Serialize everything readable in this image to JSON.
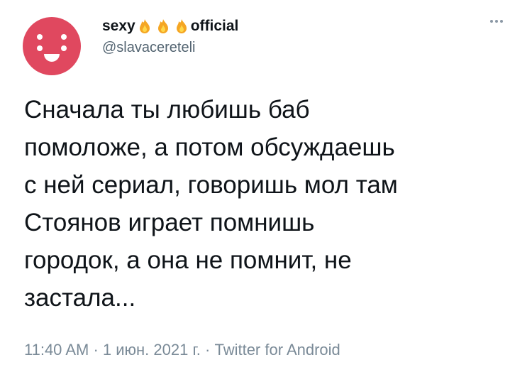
{
  "author": {
    "name_prefix": "sexy",
    "name_suffix": "official",
    "handle": "@slavacereteli",
    "avatar_color": "#e0485f"
  },
  "icons": {
    "fire": "fire-emoji",
    "more": "more-options-icon"
  },
  "tweet": {
    "text": "Сначала ты любишь баб\nпомоложе, а потом обсуждаешь\nс ней сериал, говоришь мол там\nСтоянов играет помнишь\nгородок, а она не помнит, не\nзастала..."
  },
  "meta": {
    "time": "11:40 AM",
    "sep1": " · ",
    "date": "1 июн. 2021 г.",
    "sep2": " · ",
    "client": "Twitter for Android"
  }
}
